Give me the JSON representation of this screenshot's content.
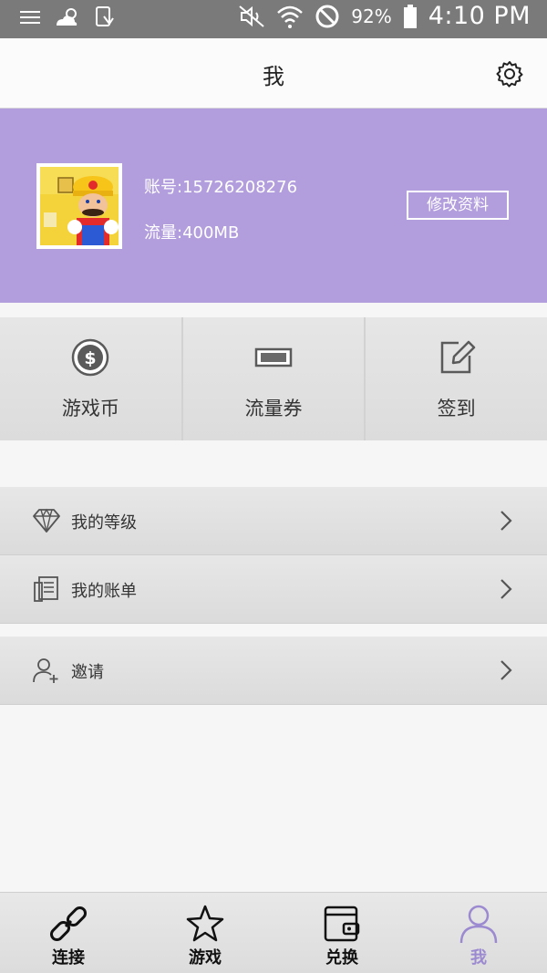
{
  "status_bar": {
    "battery": "92%",
    "time": "4:10 PM"
  },
  "header": {
    "title": "我"
  },
  "profile": {
    "account": "账号:15726208276",
    "traffic": "流量:400MB",
    "edit_button": "修改资料"
  },
  "quick_actions": [
    {
      "label": "游戏币",
      "icon": "coin-icon"
    },
    {
      "label": "流量券",
      "icon": "ticket-icon"
    },
    {
      "label": "签到",
      "icon": "edit-icon"
    }
  ],
  "menu": [
    {
      "label": "我的等级",
      "icon": "diamond-icon"
    },
    {
      "label": "我的账单",
      "icon": "bill-icon"
    },
    {
      "label": "邀请",
      "icon": "add-user-icon"
    }
  ],
  "bottom_nav": [
    {
      "label": "连接",
      "icon": "link-icon",
      "active": false
    },
    {
      "label": "游戏",
      "icon": "star-icon",
      "active": false
    },
    {
      "label": "兑换",
      "icon": "wallet-icon",
      "active": false
    },
    {
      "label": "我",
      "icon": "user-icon",
      "active": true
    }
  ],
  "colors": {
    "accent": "#b29edd",
    "active_tab": "#9c8ad1",
    "status_bar": "#7a7a7a"
  }
}
